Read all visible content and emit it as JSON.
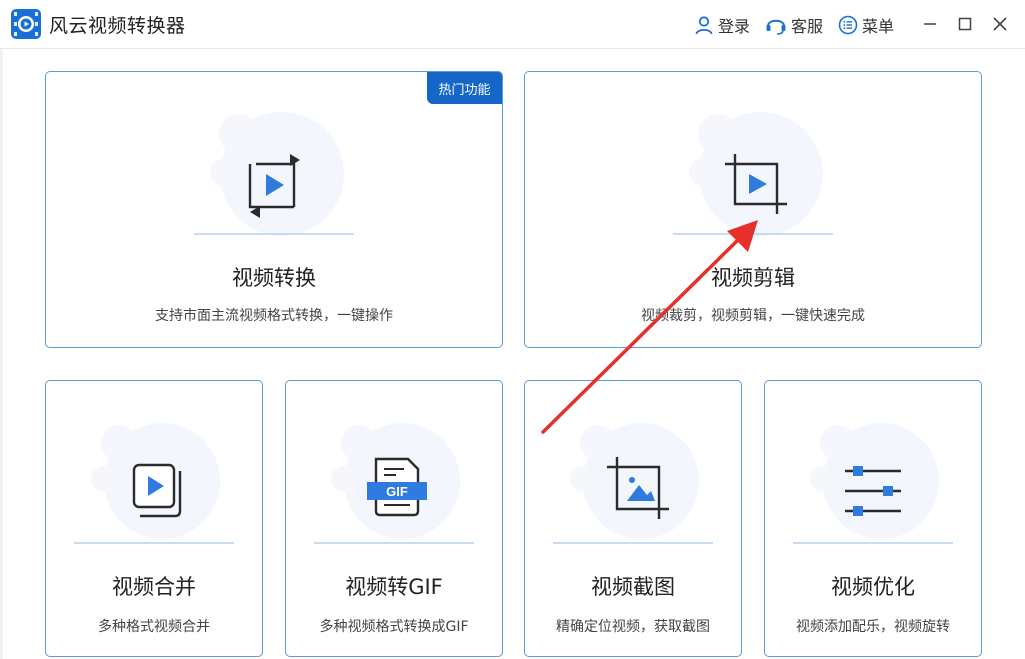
{
  "app": {
    "title": "风云视频转换器"
  },
  "header": {
    "login_label": "登录",
    "service_label": "客服",
    "menu_label": "菜单"
  },
  "cards": [
    {
      "title": "视频转换",
      "desc": "支持市面主流视频格式转换，一键操作",
      "badge": "热门功能",
      "icon": "convert-video-icon"
    },
    {
      "title": "视频剪辑",
      "desc": "视频裁剪，视频剪辑，一键快速完成",
      "icon": "crop-video-icon"
    },
    {
      "title": "视频合并",
      "desc": "多种格式视频合并",
      "icon": "merge-video-icon"
    },
    {
      "title": "视频转GIF",
      "desc": "多种视频格式转换成GIF",
      "icon": "gif-file-icon",
      "icon_text": "GIF"
    },
    {
      "title": "视频截图",
      "desc": "精确定位视频，获取截图",
      "icon": "crop-image-icon"
    },
    {
      "title": "视频优化",
      "desc": "视频添加配乐，视频旋转",
      "icon": "sliders-icon"
    }
  ],
  "colors": {
    "accent": "#1466c7",
    "card_border": "#5b9bdc",
    "icon_blue": "#2f7bdf",
    "annotation_arrow": "#e8302a"
  }
}
